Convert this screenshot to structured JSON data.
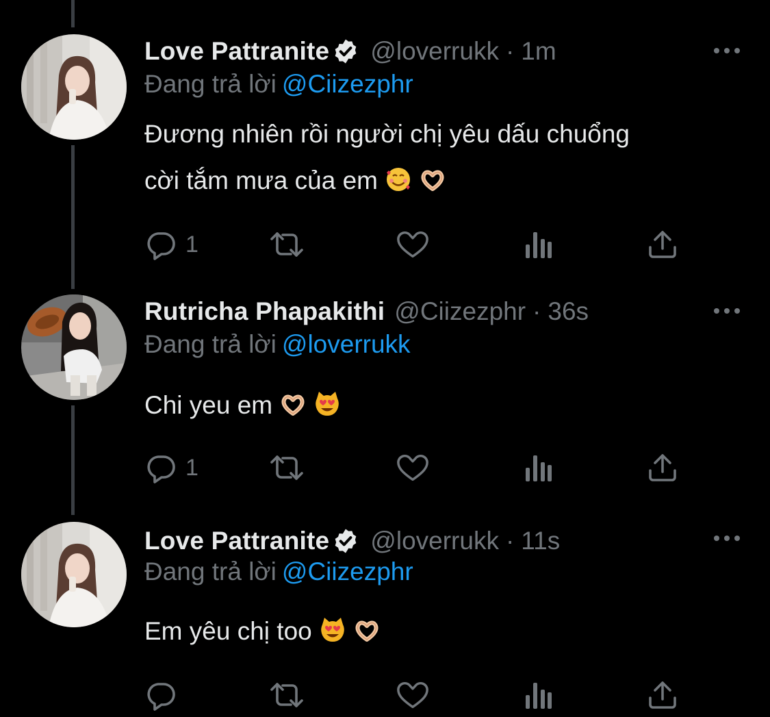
{
  "colors": {
    "background": "#000000",
    "primary_text": "#e7e9ea",
    "secondary_text": "#71767b",
    "mention": "#1d9bf0",
    "thread_line": "#3a3e43"
  },
  "tweets": [
    {
      "display_name": "Love Pattranite",
      "verified": true,
      "handle": "@loverrukk",
      "separator": "·",
      "time": "1m",
      "reply_prefix": "Đang trả lời",
      "reply_handle": "@Ciizezphr",
      "text_lines": [
        "Đương nhiên rồi người chị yêu dấu chuổng",
        "cời tắm mưa của em"
      ],
      "emojis": [
        "smiling-face-with-hearts",
        "heart-hands"
      ],
      "reply_count": "1",
      "icons": [
        "reply-icon",
        "retweet-icon",
        "like-icon",
        "analytics-icon",
        "share-icon",
        "more-icon"
      ]
    },
    {
      "display_name": "Rutricha Phapakithi",
      "verified": false,
      "handle": "@Ciizezphr",
      "separator": "·",
      "time": "36s",
      "reply_prefix": "Đang trả lời",
      "reply_handle": "@loverrukk",
      "text_lines": [
        "Chi yeu em"
      ],
      "emojis": [
        "heart-hands",
        "heart-eyes-cat"
      ],
      "reply_count": "1",
      "icons": [
        "reply-icon",
        "retweet-icon",
        "like-icon",
        "analytics-icon",
        "share-icon",
        "more-icon"
      ]
    },
    {
      "display_name": "Love Pattranite",
      "verified": true,
      "handle": "@loverrukk",
      "separator": "·",
      "time": "11s",
      "reply_prefix": "Đang trả lời",
      "reply_handle": "@Ciizezphr",
      "text_lines": [
        "Em yêu chị too"
      ],
      "emojis": [
        "heart-eyes-cat",
        "heart-hands"
      ],
      "reply_count": "",
      "icons": [
        "reply-icon",
        "retweet-icon",
        "like-icon",
        "analytics-icon",
        "share-icon",
        "more-icon"
      ]
    }
  ]
}
